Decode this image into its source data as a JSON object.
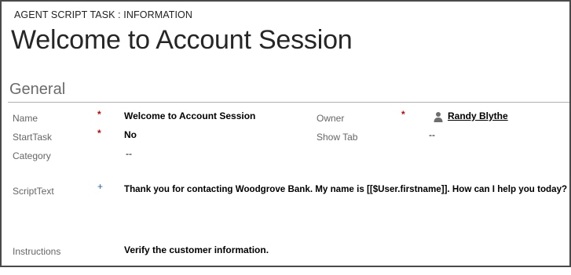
{
  "header": {
    "entity_type": "AGENT SCRIPT TASK : INFORMATION",
    "title": "Welcome to Account Session"
  },
  "section": {
    "title": "General"
  },
  "fields": {
    "name": {
      "label": "Name",
      "required_marker": "*",
      "value": "Welcome to Account Session"
    },
    "start_task": {
      "label": "StartTask",
      "required_marker": "*",
      "value": "No"
    },
    "category": {
      "label": "Category",
      "value": "--"
    },
    "script_text": {
      "label": "ScriptText",
      "recommended_marker": "+",
      "value": "Thank you for contacting Woodgrove Bank. My name is [[$User.firstname]]. How can I help you today?"
    },
    "instructions": {
      "label": "Instructions",
      "value": "Verify the customer information."
    },
    "owner": {
      "label": "Owner",
      "required_marker": "*",
      "value": "Randy Blythe",
      "icon": "person-icon"
    },
    "show_tab": {
      "label": "Show Tab",
      "value": "--"
    }
  },
  "colors": {
    "required": "#cc0000",
    "recommended": "#1f5fbf",
    "label": "#666666",
    "border": "#4a4a4a"
  }
}
